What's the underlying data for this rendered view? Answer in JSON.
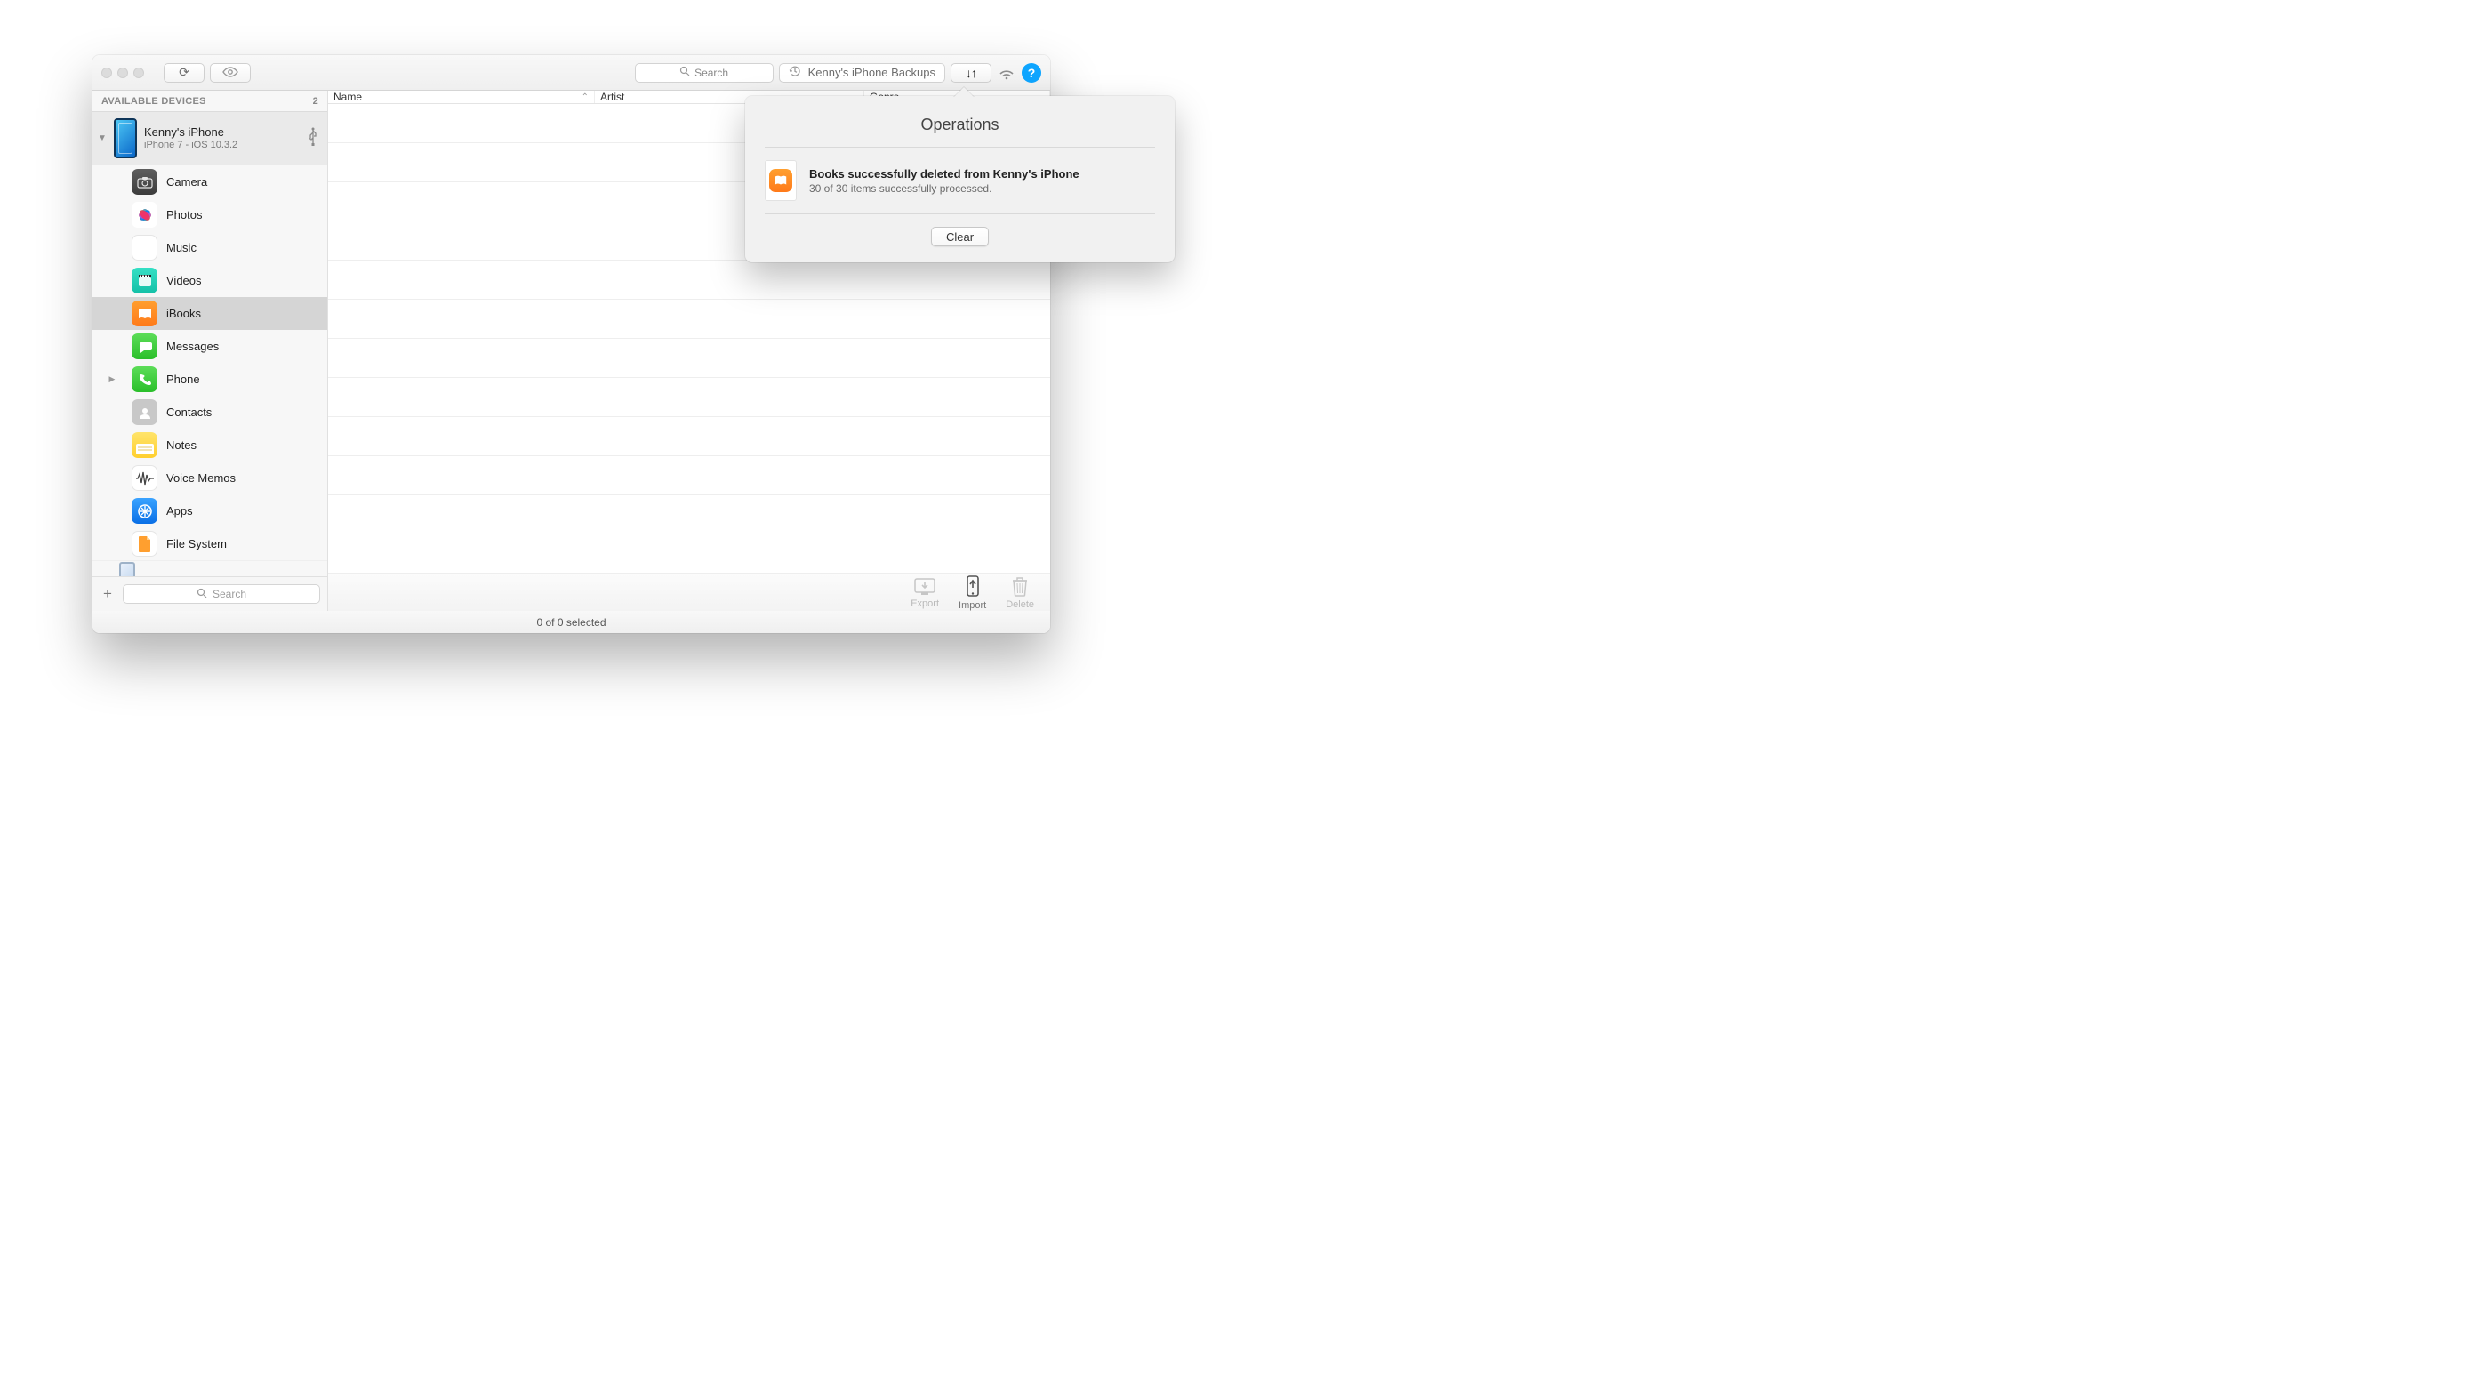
{
  "toolbar": {
    "search_placeholder": "Search",
    "backups_label": "Kenny's iPhone Backups"
  },
  "sidebar": {
    "header": "AVAILABLE DEVICES",
    "device_count": "2",
    "device": {
      "name": "Kenny's iPhone",
      "subtitle": "iPhone 7 - iOS 10.3.2"
    },
    "items": [
      {
        "label": "Camera"
      },
      {
        "label": "Photos"
      },
      {
        "label": "Music"
      },
      {
        "label": "Videos"
      },
      {
        "label": "iBooks"
      },
      {
        "label": "Messages"
      },
      {
        "label": "Phone"
      },
      {
        "label": "Contacts"
      },
      {
        "label": "Notes"
      },
      {
        "label": "Voice Memos"
      },
      {
        "label": "Apps"
      },
      {
        "label": "File System"
      }
    ],
    "footer_search_placeholder": "Search"
  },
  "columns": {
    "name": "Name",
    "artist": "Artist",
    "genre": "Genre"
  },
  "actions": {
    "export": "Export",
    "import": "Import",
    "delete": "Delete"
  },
  "status": "0 of 0 selected",
  "popover": {
    "title": "Operations",
    "item_title": "Books successfully deleted from Kenny's iPhone",
    "item_sub": "30 of 30 items successfully processed.",
    "clear": "Clear"
  }
}
